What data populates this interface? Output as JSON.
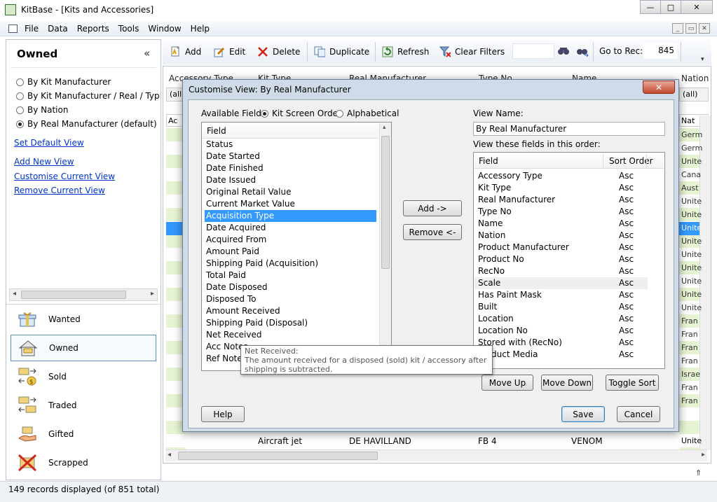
{
  "window": {
    "title": "KitBase - [Kits and Accessories]",
    "minimize": "—",
    "maximize": "□",
    "close": "✕"
  },
  "menu": [
    "File",
    "Data",
    "Reports",
    "Tools",
    "Window",
    "Help"
  ],
  "left_panel": {
    "title": "Owned",
    "collapse": "«",
    "views": [
      {
        "label": "By Kit Manufacturer",
        "selected": false
      },
      {
        "label": "By Kit Manufacturer / Real / Type No /",
        "selected": false
      },
      {
        "label": "By Nation",
        "selected": false
      },
      {
        "label": "By Real Manufacturer (default)",
        "selected": true
      }
    ],
    "links": {
      "set_default": "Set Default View",
      "add_new": "Add New View",
      "customise": "Customise Current View",
      "remove": "Remove Current View"
    },
    "nav": [
      {
        "label": "Wanted",
        "icon": "gift-icon",
        "active": false
      },
      {
        "label": "Owned",
        "icon": "house-icon",
        "active": true
      },
      {
        "label": "Sold",
        "icon": "sold-icon",
        "active": false
      },
      {
        "label": "Traded",
        "icon": "traded-icon",
        "active": false
      },
      {
        "label": "Gifted",
        "icon": "gifted-icon",
        "active": false
      },
      {
        "label": "Scrapped",
        "icon": "scrapped-icon",
        "active": false
      }
    ]
  },
  "status": "149 records displayed (of 851 total)",
  "toolbar": {
    "add": "Add",
    "edit": "Edit",
    "delete": "Delete",
    "duplicate": "Duplicate",
    "refresh": "Refresh",
    "clear_filters": "Clear Filters",
    "goto_label": "Go to Rec:",
    "goto_value": "845"
  },
  "grid": {
    "headers": [
      "Accessory Type",
      "Kit Type",
      "Real Manufacturer",
      "Type No",
      "Name",
      "Nation"
    ],
    "filter_all": "(all)",
    "col_a": "Ac",
    "col_nat": "Nat",
    "nation_cells": [
      "Germ",
      "Germ",
      "Unite",
      "Cana",
      "Aust",
      "Unite",
      "Unite",
      "Unite",
      "Unite",
      "Unite",
      "Unite",
      "Unite",
      "Unite",
      "Unite",
      "Fran",
      "Fran",
      "Fran",
      "Fran",
      "Israe",
      "Fran",
      "Fran"
    ],
    "bottom_row": {
      "kit_type": "Aircraft jet",
      "real_manufacturer": "DE HAVILLAND",
      "type_no": "FB 4",
      "name": "VENOM",
      "nation": "Unite"
    }
  },
  "dialog": {
    "title": "Customise View: By Real Manufacturer",
    "close": "✕",
    "available_label": "Available Fields:",
    "order_kit_screen": "Kit Screen Order",
    "order_alpha": "Alphabetical",
    "field_header": "Field",
    "available_fields": [
      "Status",
      "Date Started",
      "Date Finished",
      "Date Issued",
      "Original Retail Value",
      "Current Market Value",
      "Acquisition Type",
      "Date Acquired",
      "Acquired From",
      "Amount Paid",
      "Shipping Paid (Acquisition)",
      "Total Paid",
      "Date Disposed",
      "Disposed To",
      "Amount Received",
      "Shipping Paid (Disposal)",
      "Net Received",
      "Acc Notes",
      "Ref Notes"
    ],
    "selected_available": "Acquisition Type",
    "add_button": "Add ->",
    "remove_button": "Remove <-",
    "view_name_label": "View Name:",
    "view_name_value": "By Real Manufacturer",
    "order_label": "View these fields in this order:",
    "sort_header": "Sort Order",
    "view_fields": [
      {
        "field": "Accessory Type",
        "sort": "Asc"
      },
      {
        "field": "Kit Type",
        "sort": "Asc"
      },
      {
        "field": "Real Manufacturer",
        "sort": "Asc"
      },
      {
        "field": "Type No",
        "sort": "Asc"
      },
      {
        "field": "Name",
        "sort": "Asc"
      },
      {
        "field": "Nation",
        "sort": "Asc"
      },
      {
        "field": "Product Manufacturer",
        "sort": "Asc"
      },
      {
        "field": "Product No",
        "sort": "Asc"
      },
      {
        "field": "RecNo",
        "sort": "Asc"
      },
      {
        "field": "Scale",
        "sort": "Asc"
      },
      {
        "field": "Has Paint Mask",
        "sort": "Asc"
      },
      {
        "field": "Built",
        "sort": "Asc"
      },
      {
        "field": "Location",
        "sort": "Asc"
      },
      {
        "field": "Location No",
        "sort": "Asc"
      },
      {
        "field": "Stored with (RecNo)",
        "sort": "Asc"
      },
      {
        "field": "Product Media",
        "sort": "Asc"
      }
    ],
    "move_up": "Move Up",
    "move_down": "Move Down",
    "toggle_sort": "Toggle Sort",
    "help": "Help",
    "save": "Save",
    "cancel": "Cancel",
    "tooltip_title": "Net Received:",
    "tooltip_text": "The amount received for a disposed (sold) kit / accessory after shipping is subtracted."
  }
}
